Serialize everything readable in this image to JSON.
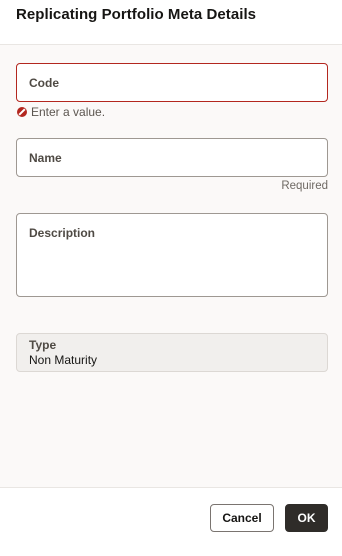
{
  "dialog": {
    "title": "Replicating Portfolio Meta Details"
  },
  "form": {
    "code": {
      "label": "Code",
      "value": "",
      "error": "Enter a value."
    },
    "name": {
      "label": "Name",
      "value": "",
      "hint": "Required"
    },
    "description": {
      "label": "Description",
      "value": ""
    },
    "type": {
      "label": "Type",
      "value": "Non Maturity"
    }
  },
  "footer": {
    "cancel_label": "Cancel",
    "ok_label": "OK"
  },
  "colors": {
    "error": "#b3271f",
    "primary_button": "#2f2c29",
    "background": "#fbf9f8"
  },
  "icons": {
    "error": "error-circle-icon"
  }
}
